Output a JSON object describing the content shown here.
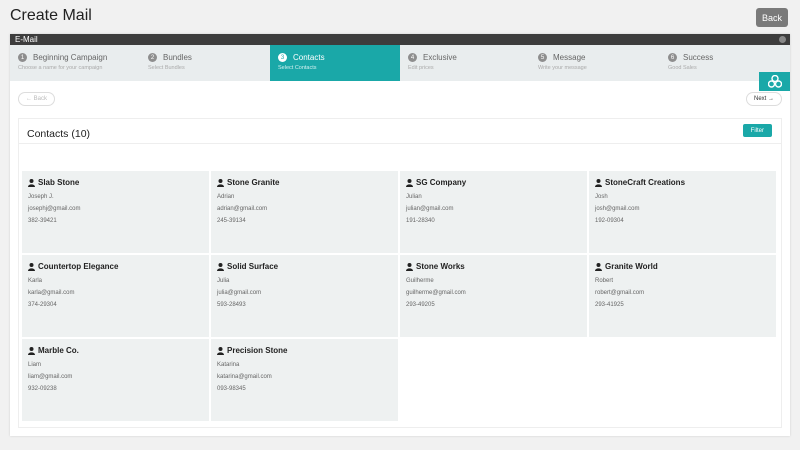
{
  "page": {
    "title": "Create Mail",
    "back_button": "Back"
  },
  "panel": {
    "header_title": "E-Mail"
  },
  "steps": [
    {
      "num": "1",
      "title": "Beginning Campaign",
      "subtitle": "Choose a name for your campaign"
    },
    {
      "num": "2",
      "title": "Bundles",
      "subtitle": "Select Bundles"
    },
    {
      "num": "3",
      "title": "Contacts",
      "subtitle": "Select Contacts"
    },
    {
      "num": "4",
      "title": "Exclusive",
      "subtitle": "Edit prices"
    },
    {
      "num": "5",
      "title": "Message",
      "subtitle": "Write your message"
    },
    {
      "num": "6",
      "title": "Success",
      "subtitle": "Good Sales"
    }
  ],
  "nav": {
    "back": "← Back",
    "next": "Next →"
  },
  "contacts": {
    "title": "Contacts (10)",
    "filter": "Filter",
    "items": [
      {
        "company": "Slab Stone",
        "person": "Joseph J.",
        "email": "josephj@gmail.com",
        "phone": "382-39421"
      },
      {
        "company": "Stone Granite",
        "person": "Adrian",
        "email": "adrian@gmail.com",
        "phone": "245-39134"
      },
      {
        "company": "SG Company",
        "person": "Julian",
        "email": "julian@gmail.com",
        "phone": "191-28340"
      },
      {
        "company": "StoneCraft Creations",
        "person": "Josh",
        "email": "josh@gmail.com",
        "phone": "192-09304"
      },
      {
        "company": "Countertop Elegance",
        "person": "Karla",
        "email": "karla@gmail.com",
        "phone": "374-29304"
      },
      {
        "company": "Solid Surface",
        "person": "Julia",
        "email": "julia@gmail.com",
        "phone": "593-28493"
      },
      {
        "company": "Stone Works",
        "person": "Guilherme",
        "email": "guilherme@gmail.com",
        "phone": "293-49205"
      },
      {
        "company": "Granite World",
        "person": "Robert",
        "email": "robert@gmail.com",
        "phone": "293-41925"
      },
      {
        "company": "Marble Co.",
        "person": "Liam",
        "email": "liam@gmail.com",
        "phone": "932-09238"
      },
      {
        "company": "Precision Stone",
        "person": "Katarina",
        "email": "katarina@gmail.com",
        "phone": "093-98345"
      }
    ]
  },
  "colors": {
    "accent": "#1aa8a8",
    "header_bar": "#3d3d3d",
    "card_bg": "#eef1f1"
  },
  "active_step": 2
}
